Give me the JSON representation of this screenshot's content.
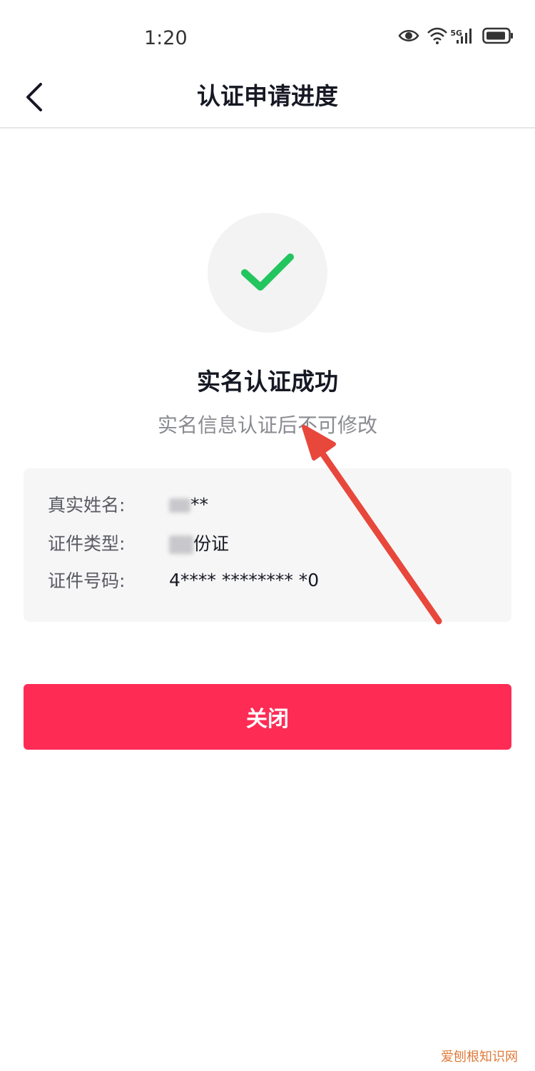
{
  "status_bar": {
    "time": "1:20",
    "network_label": "5G"
  },
  "nav": {
    "title": "认证申请进度",
    "back_icon": "chevron-left-icon"
  },
  "result": {
    "icon": "check-icon",
    "icon_color": "#22c55e",
    "title": "实名认证成功",
    "subtitle": "实名信息认证后不可修改"
  },
  "info": {
    "rows": [
      {
        "label": "真实姓名:",
        "value": "**"
      },
      {
        "label": "证件类型:",
        "value": "份证"
      },
      {
        "label": "证件号码:",
        "value": "4****  ********  *0"
      }
    ]
  },
  "close_button": {
    "label": "关闭",
    "color": "#fe2c55"
  },
  "annotation": {
    "color": "#e8473b"
  },
  "watermark": "爱刨根知识网"
}
